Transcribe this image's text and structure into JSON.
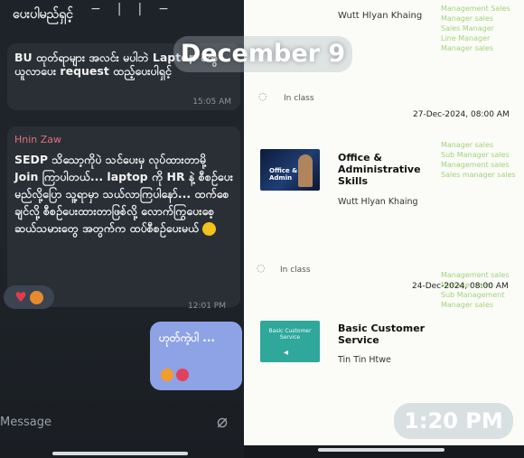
{
  "chat": {
    "top_title": "ပေးပါမည်ရှင့်",
    "top_icons": [
      "minus-icon",
      "vertical-bar-icon",
      "vertical-bar-icon",
      "minus-icon"
    ],
    "message1": {
      "text": "BU ထုတ်ရာများ အလင်း မပါဘဲ Laptop တွေ ယူလာပေး request ထည့်ပေးပါရှင့်",
      "time": "15:05 AM"
    },
    "message2": {
      "sender": "Hnin Zaw",
      "text": "SEDP သိသော့ကိုပဲ သင်ပေးမှ လုပ်ထားတာမို့ Join ကြာပါတယ်... laptop ကို HR နဲ့ စီစဉ်ပေးမည်လို့ပြော သူ့ရာမှာ သယ်လာကြပါနော်... ထက်စေချင်လို့ စီစဉ်ပေးထားတာဖြစ်လို့ လောက်ကြွပေးစေ့ ဆယ်သမားတွေ အတွက်က ထပ်စီစဉ်ပေးမယ်",
      "reactions": [
        "heart",
        "hug"
      ],
      "time": "12:01 PM"
    },
    "outgoing": {
      "text": "ဟုတ်ကဲ့ပါ ...",
      "reactions": [
        "hug",
        "heart"
      ]
    },
    "composer": {
      "placeholder": "Message",
      "attach_icon": "paperclip-icon"
    }
  },
  "learning": {
    "top_name": "Wutt Hlyan Khaing",
    "rows": [
      {
        "status_label": "In class",
        "date": "27-Dec-2024, 08:00 AM",
        "course_title": "Office & Administrative Skills",
        "author": "Wutt Hlyan Khaing",
        "thumb_caption": "Office & Admin"
      },
      {
        "status_label": "In class",
        "date": "24-Dec-2024, 08:00 AM",
        "course_title": "Basic Customer Service",
        "author": "Tin Tin Htwe",
        "thumb_caption": "Basic Customer Service"
      }
    ],
    "side_notes": [
      "Management Sales",
      "Manager sales",
      "Sales Manager",
      "Line Manager",
      "Manager sales",
      "Manager sales",
      "Sub Manager sales",
      "Management sales",
      "Sales manager sales",
      "Management sales",
      "Manager sales",
      "Sub Management",
      "Manager sales"
    ],
    "accent_green": "#a3d27d"
  },
  "overlay": {
    "date": "December 9",
    "time": "1:20 PM"
  }
}
